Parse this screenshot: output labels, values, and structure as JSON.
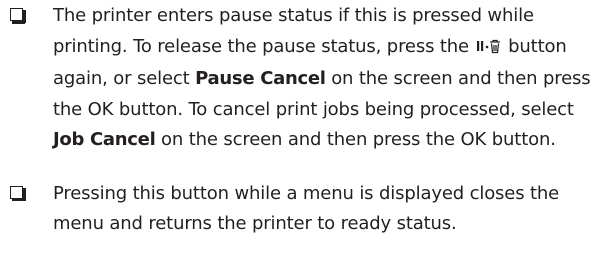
{
  "items": [
    {
      "parts": [
        "The printer enters pause status if this is pressed while printing. To release the pause status, press the ",
        " button again, or select ",
        "Pause Cancel",
        " on the screen and then press the OK button. To cancel print jobs being processed, select ",
        "Job Cancel",
        " on the screen and then press the OK button."
      ],
      "button_icon": "pause-trash-icon"
    },
    {
      "text": "Pressing this button while a menu is displayed closes the menu and returns the printer to ready status."
    }
  ],
  "bullet_icon": "checkbox-bullet-icon"
}
